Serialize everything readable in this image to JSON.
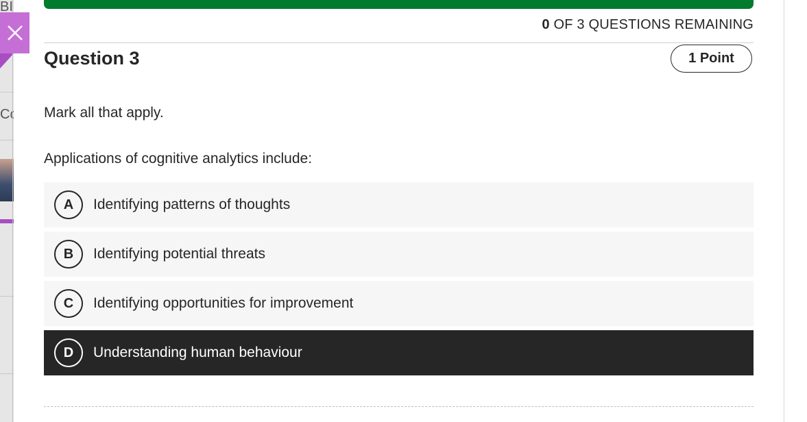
{
  "background": {
    "fragment_top": "BI",
    "fragment_side": "Co"
  },
  "close": {
    "icon": "close-icon"
  },
  "progress": {
    "fraction_complete": 1.0,
    "color": "#037b2f"
  },
  "remaining": {
    "count": "0",
    "text": " OF 3 QUESTIONS REMAINING"
  },
  "question": {
    "title": "Question 3",
    "points": "1 Point",
    "instruction": "Mark all that apply.",
    "prompt": "Applications of cognitive analytics include:"
  },
  "options": [
    {
      "letter": "A",
      "text": "Identifying patterns of thoughts",
      "selected": false
    },
    {
      "letter": "B",
      "text": "Identifying potential threats",
      "selected": false
    },
    {
      "letter": "C",
      "text": "Identifying opportunities for improvement",
      "selected": false
    },
    {
      "letter": "D",
      "text": "Understanding human behaviour",
      "selected": true
    }
  ],
  "colors": {
    "accent_close": "#c56fd6",
    "selected_bg": "#262626",
    "option_bg": "#f6f6f6"
  }
}
